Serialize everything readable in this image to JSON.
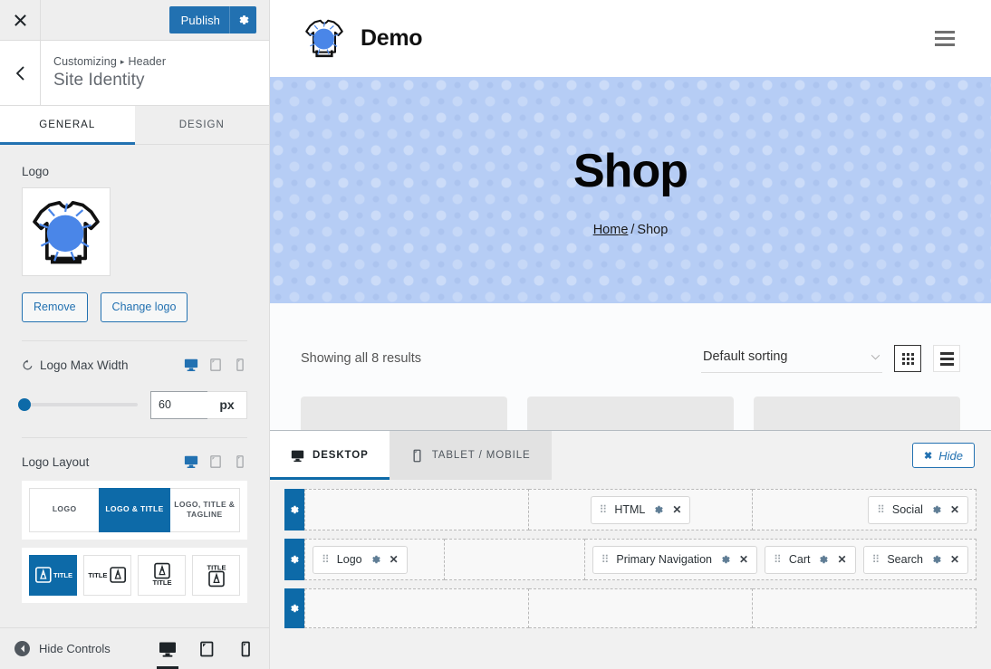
{
  "customizer": {
    "close_icon": "close-icon",
    "publish_label": "Publish",
    "publish_gear_icon": "gear-icon",
    "back_icon": "chevron-left-icon",
    "breadcrumb_root": "Customizing",
    "breadcrumb_sep": "▸",
    "breadcrumb_current": "Header",
    "panel_title": "Site Identity",
    "tabs": [
      {
        "label": "GENERAL",
        "active": true
      },
      {
        "label": "DESIGN",
        "active": false
      }
    ],
    "logo": {
      "label": "Logo",
      "thumb_icon": "tshirt-logo-image",
      "remove_label": "Remove",
      "change_label": "Change logo"
    },
    "logo_max_width": {
      "label": "Logo Max Width",
      "reset_icon": "reset-icon",
      "value": "60",
      "unit": "px",
      "devices": [
        {
          "name": "desktop",
          "active": true
        },
        {
          "name": "tablet",
          "active": false
        },
        {
          "name": "mobile",
          "active": false
        }
      ]
    },
    "logo_layout": {
      "label": "Logo Layout",
      "devices": [
        {
          "name": "desktop",
          "active": true
        },
        {
          "name": "tablet",
          "active": false
        },
        {
          "name": "mobile",
          "active": false
        }
      ],
      "options": [
        {
          "label": "LOGO",
          "active": false
        },
        {
          "label": "LOGO & TITLE",
          "active": true
        },
        {
          "label": "LOGO, TITLE & TAGLINE",
          "active": false
        }
      ],
      "positions": [
        {
          "name": "logo-left-title-right",
          "title": "TITLE",
          "active": true
        },
        {
          "name": "title-left-logo-right",
          "title": "TITLE",
          "active": false
        },
        {
          "name": "logo-above-title",
          "title": "TITLE",
          "active": false
        },
        {
          "name": "title-above-logo",
          "title": "TITLE",
          "active": false
        }
      ]
    },
    "footer": {
      "hide_controls_label": "Hide Controls",
      "collapse_icon": "collapse-left-icon",
      "devices": [
        {
          "name": "desktop",
          "active": true
        },
        {
          "name": "tablet",
          "active": false
        },
        {
          "name": "mobile",
          "active": false
        }
      ]
    }
  },
  "preview": {
    "site_logo_icon": "tshirt-logo-image",
    "site_title": "Demo",
    "menu_icon": "hamburger-menu-icon",
    "hero": {
      "title": "Shop",
      "breadcrumb_home": "Home",
      "breadcrumb_sep": "/",
      "breadcrumb_current": "Shop"
    },
    "shop": {
      "result_count": "Showing all 8 results",
      "sorting_value": "Default sorting",
      "chevron_icon": "chevron-down-icon",
      "grid_view_icon": "grid-view-icon",
      "list_view_icon": "list-view-icon",
      "grid_view_active": true
    }
  },
  "builder": {
    "tabs": [
      {
        "label": "DESKTOP",
        "icon": "desktop-icon",
        "active": true
      },
      {
        "label": "TABLET / MOBILE",
        "icon": "tablet-icon",
        "active": false
      }
    ],
    "hide_label": "Hide",
    "hide_x": "✖",
    "rows": [
      {
        "name": "above-header-row",
        "gear_icon": "gear-icon",
        "zones": [
          {
            "align": "left",
            "items": []
          },
          {
            "align": "center",
            "items": [
              {
                "label": "HTML",
                "gear_icon": "gear-icon",
                "remove_icon": "close-icon"
              }
            ]
          },
          {
            "align": "right",
            "items": [
              {
                "label": "Social",
                "gear_icon": "gear-icon",
                "remove_icon": "close-icon"
              }
            ]
          }
        ]
      },
      {
        "name": "primary-header-row",
        "gear_icon": "gear-icon",
        "zones": [
          {
            "align": "left",
            "items": [
              {
                "label": "Logo",
                "gear_icon": "gear-icon",
                "remove_icon": "close-icon"
              }
            ]
          },
          {
            "align": "center",
            "items": []
          },
          {
            "align": "right",
            "items": [
              {
                "label": "Primary Navigation",
                "gear_icon": "gear-icon",
                "remove_icon": "close-icon"
              },
              {
                "label": "Cart",
                "gear_icon": "gear-icon",
                "remove_icon": "close-icon"
              },
              {
                "label": "Search",
                "gear_icon": "gear-icon",
                "remove_icon": "close-icon"
              }
            ]
          }
        ]
      },
      {
        "name": "below-header-row",
        "gear_icon": "gear-icon",
        "zones": [
          {
            "align": "left",
            "items": []
          },
          {
            "align": "center",
            "items": []
          },
          {
            "align": "right",
            "items": []
          }
        ]
      }
    ]
  },
  "colors": {
    "accent": "#2271b1",
    "builder_accent": "#0d6aa8",
    "hero_bg": "#b6cdf5",
    "logo_blue": "#4a86e8"
  }
}
